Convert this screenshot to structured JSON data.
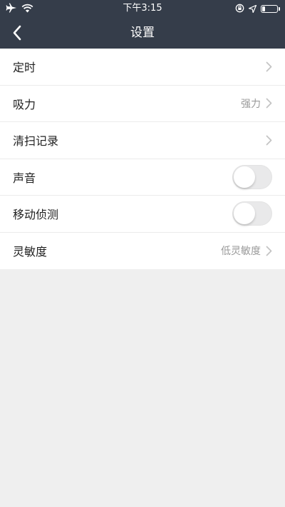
{
  "status_bar": {
    "time": "下午3:15",
    "icons": [
      "airplane-icon",
      "wifi-icon",
      "lock-rotation-icon",
      "location-icon",
      "battery-icon"
    ],
    "battery_level_fraction": 0.2
  },
  "nav": {
    "title": "设置",
    "back_icon": "chevron-left-icon"
  },
  "settings": [
    {
      "label": "定时",
      "type": "link",
      "value": ""
    },
    {
      "label": "吸力",
      "type": "link",
      "value": "强力"
    },
    {
      "label": "清扫记录",
      "type": "link",
      "value": ""
    },
    {
      "label": "声音",
      "type": "toggle",
      "on": false
    },
    {
      "label": "移动侦测",
      "type": "toggle",
      "on": false
    },
    {
      "label": "灵敏度",
      "type": "link",
      "value": "低灵敏度"
    }
  ],
  "colors": {
    "header_bg": "#353d4a",
    "page_bg": "#efefef",
    "row_bg": "#ffffff",
    "value_text": "#9a9a9a"
  }
}
